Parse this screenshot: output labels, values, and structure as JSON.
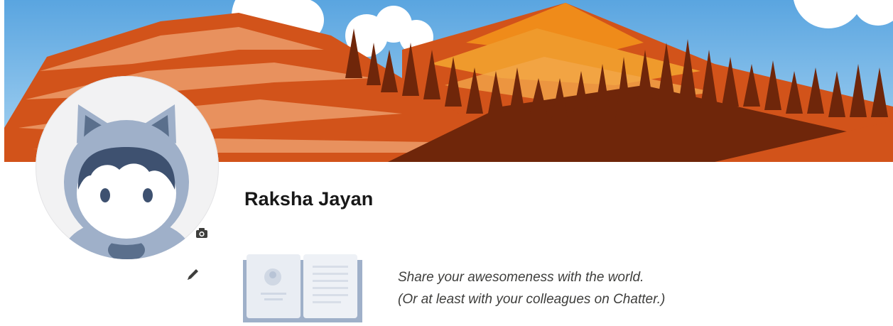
{
  "profile": {
    "name": "Raksha Jayan",
    "tagline_line1": "Share your awesomeness with the world.",
    "tagline_line2": "(Or at least with your colleagues on Chatter.)"
  },
  "icons": {
    "camera": "camera-icon",
    "edit": "pencil-icon",
    "empty_state": "open-book-illustration",
    "avatar": "astro-avatar"
  },
  "colors": {
    "sky": "#8fc3e8",
    "mountain_orange": "#d2531a",
    "mountain_light": "#e8915e",
    "peak_gold": "#ef8b1a",
    "trees": "#6f260a",
    "avatar_gray": "#9fb0c9",
    "avatar_dark": "#5a6f8c"
  }
}
